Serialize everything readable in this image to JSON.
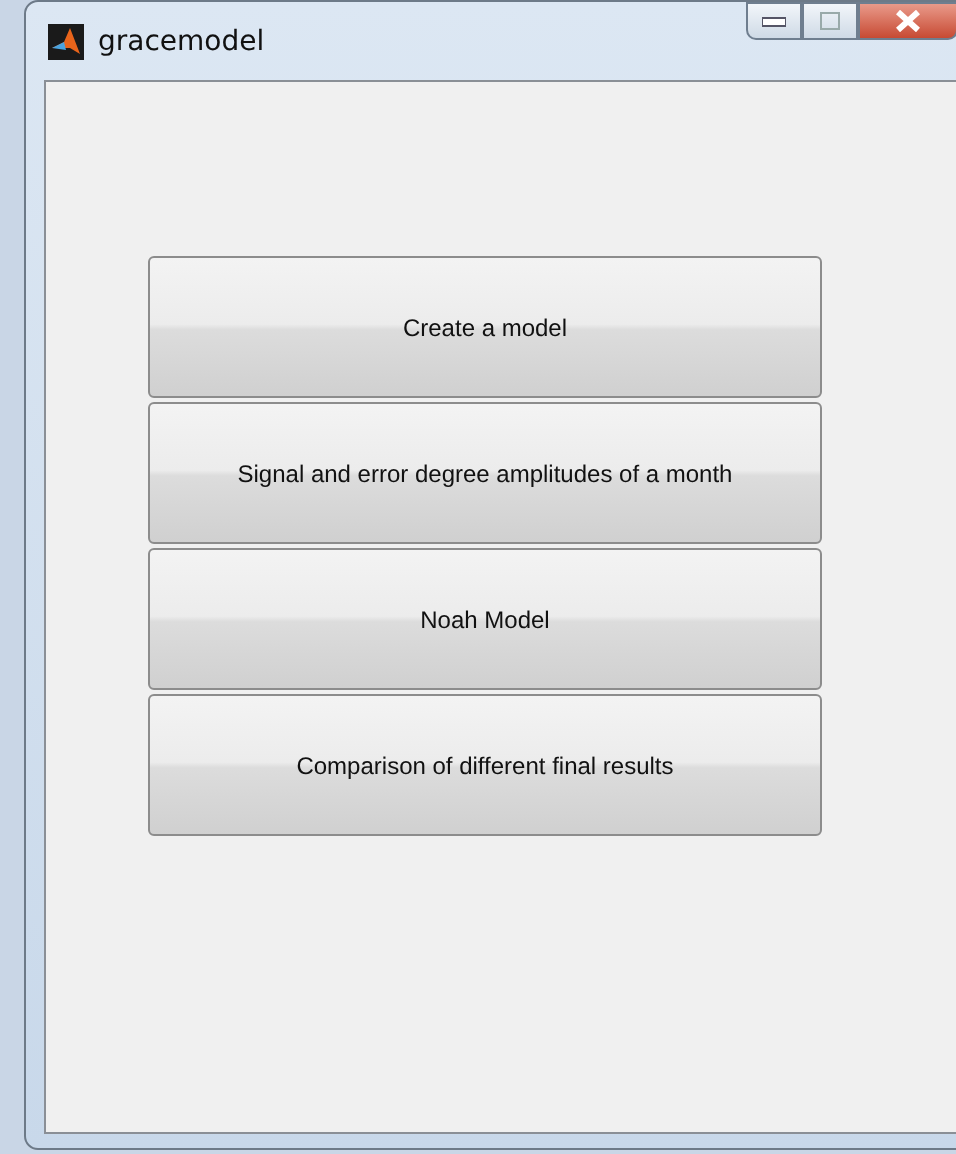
{
  "window": {
    "title": "gracemodel"
  },
  "buttons": [
    {
      "label": "Create a model"
    },
    {
      "label": "Signal and error degree amplitudes of a month"
    },
    {
      "label": "Noah Model"
    },
    {
      "label": "Comparison of different final results"
    }
  ]
}
